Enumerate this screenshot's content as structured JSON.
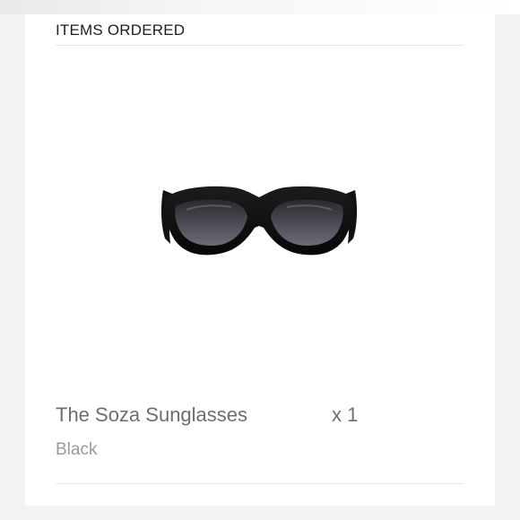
{
  "order": {
    "section_title": "ITEMS ORDERED",
    "item": {
      "name": "The Soza Sunglasses",
      "quantity": "x 1",
      "variant": "Black",
      "image_icon": "sunglasses-product-image"
    }
  },
  "colors": {
    "background": "#f2f2f2",
    "card": "#ffffff",
    "title_text": "#1d1d1d",
    "product_text": "#6e6e6e",
    "variant_text": "#9a9a9a",
    "frame": "#101010",
    "lens": "#3b3940"
  }
}
